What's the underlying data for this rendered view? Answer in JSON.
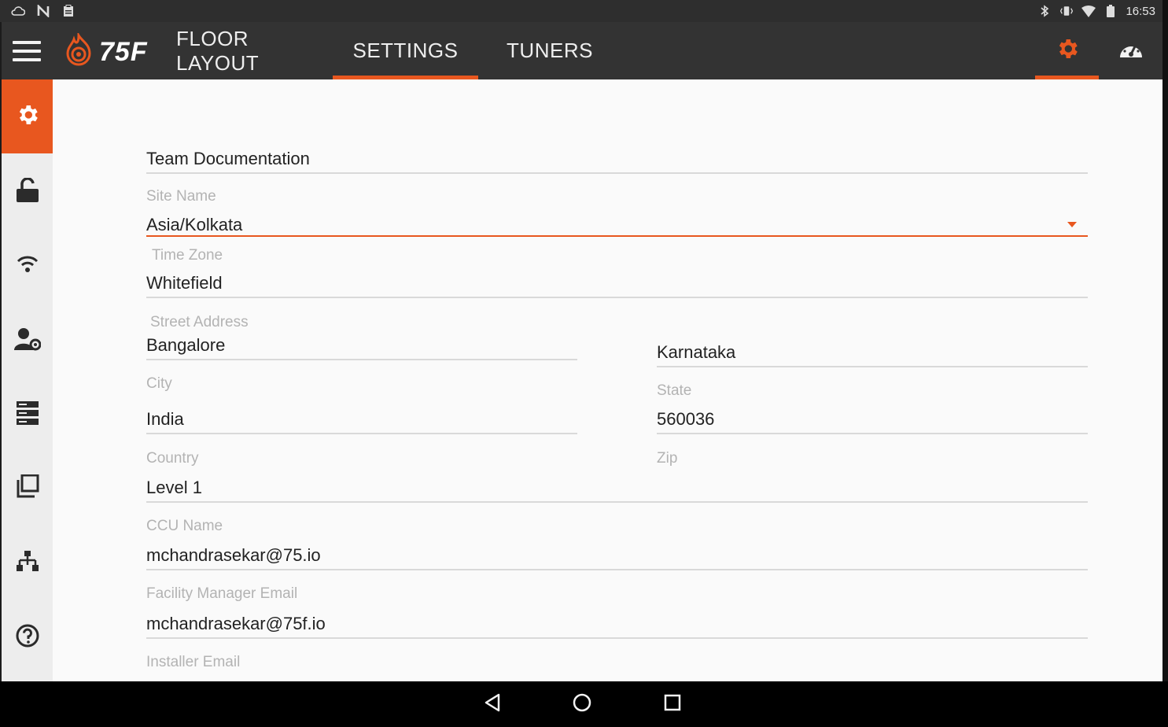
{
  "status_bar": {
    "time": "16:53",
    "left_icons": [
      "cloud-icon",
      "n-icon",
      "clipboard-icon"
    ],
    "right_icons": [
      "bluetooth-icon",
      "vibrate-icon",
      "wifi-signal-icon",
      "battery-icon"
    ]
  },
  "app_bar": {
    "brand": "75F",
    "tabs": [
      {
        "label": "FLOOR LAYOUT",
        "active": false
      },
      {
        "label": "SETTINGS",
        "active": true
      },
      {
        "label": "TUNERS",
        "active": false
      }
    ],
    "accent_color": "#e8571f"
  },
  "side_rail": {
    "items": [
      "gear-icon",
      "unlock-icon",
      "wifi-icon",
      "user-settings-icon",
      "server-icon",
      "copy-icon",
      "network-icon",
      "help-icon"
    ]
  },
  "form": {
    "site_name": {
      "value": "Team Documentation",
      "label": "Site Name"
    },
    "time_zone": {
      "value": "Asia/Kolkata",
      "label": "Time Zone"
    },
    "street_address": {
      "value": "Whitefield",
      "label": "Street Address"
    },
    "city": {
      "value": "Bangalore",
      "label": "City"
    },
    "state": {
      "value": "Karnataka",
      "label": "State"
    },
    "country": {
      "value": "India",
      "label": "Country"
    },
    "zip": {
      "value": "560036",
      "label": "Zip"
    },
    "ccu_name": {
      "value": "Level 1",
      "label": "CCU Name"
    },
    "facility_manager_email": {
      "value": "mchandrasekar@75.io",
      "label": "Facility Manager Email"
    },
    "installer_email": {
      "value": "mchandrasekar@75f.io",
      "label": "Installer Email"
    }
  },
  "nav_bar": {
    "buttons": [
      "back-icon",
      "home-icon",
      "recents-icon"
    ]
  }
}
